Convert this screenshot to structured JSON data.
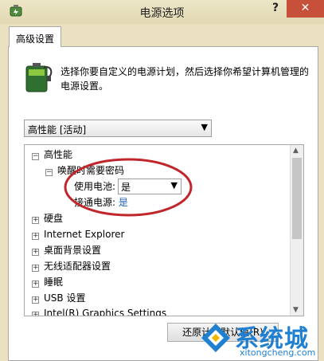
{
  "window": {
    "title": "电源选项",
    "help": "?",
    "close": "✕"
  },
  "tab": {
    "label": "高级设置"
  },
  "description": "选择你要自定义的电源计划，然后选择你希望计算机管理的电源设置。",
  "plan_select": {
    "value": "高性能 [活动]"
  },
  "tree": {
    "root": "高性能",
    "sub": "唤醒时需要密码",
    "battery_label": "使用电池:",
    "battery_value": "是",
    "plugged_label": "接通电源:",
    "plugged_value": "是",
    "items": [
      "硬盘",
      "Internet Explorer",
      "桌面背景设置",
      "无线适配器设置",
      "睡眠",
      "USB 设置",
      "Intel(R) Graphics Settings"
    ]
  },
  "restore_button": "还原计划默认值(R)",
  "watermark": {
    "cn": "系统城",
    "en": "xitongcheng.com"
  },
  "colors": {
    "titlebar": "#e6dfbd",
    "close": "#c7503b",
    "annotation": "#c0262b",
    "link": "#1a5fb4",
    "watermark": "#1f7fd0"
  }
}
